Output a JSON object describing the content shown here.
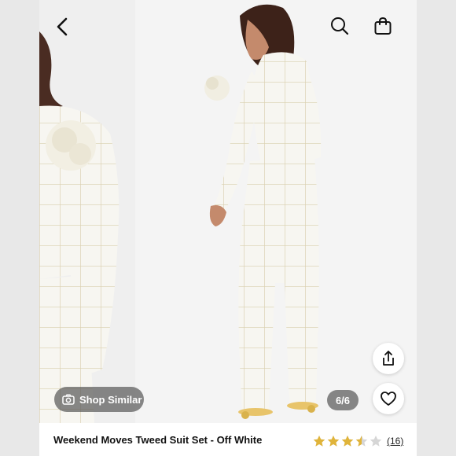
{
  "product": {
    "title": "Weekend Moves Tweed Suit Set - Off White",
    "rating": 3.5,
    "rating_max": 5,
    "review_count": "(16)"
  },
  "gallery": {
    "shop_similar_label": "Shop Similar",
    "counter": "6/6"
  },
  "icons": {
    "back": "chevron-left-icon",
    "search": "search-icon",
    "bag": "shopping-bag-icon",
    "share": "share-icon",
    "favorite": "heart-icon",
    "shop_similar": "camera-icon"
  },
  "colors": {
    "star_filled": "#e0b43a",
    "star_empty": "#d6d6d6",
    "overlay_pill": "#5a5a5a"
  }
}
